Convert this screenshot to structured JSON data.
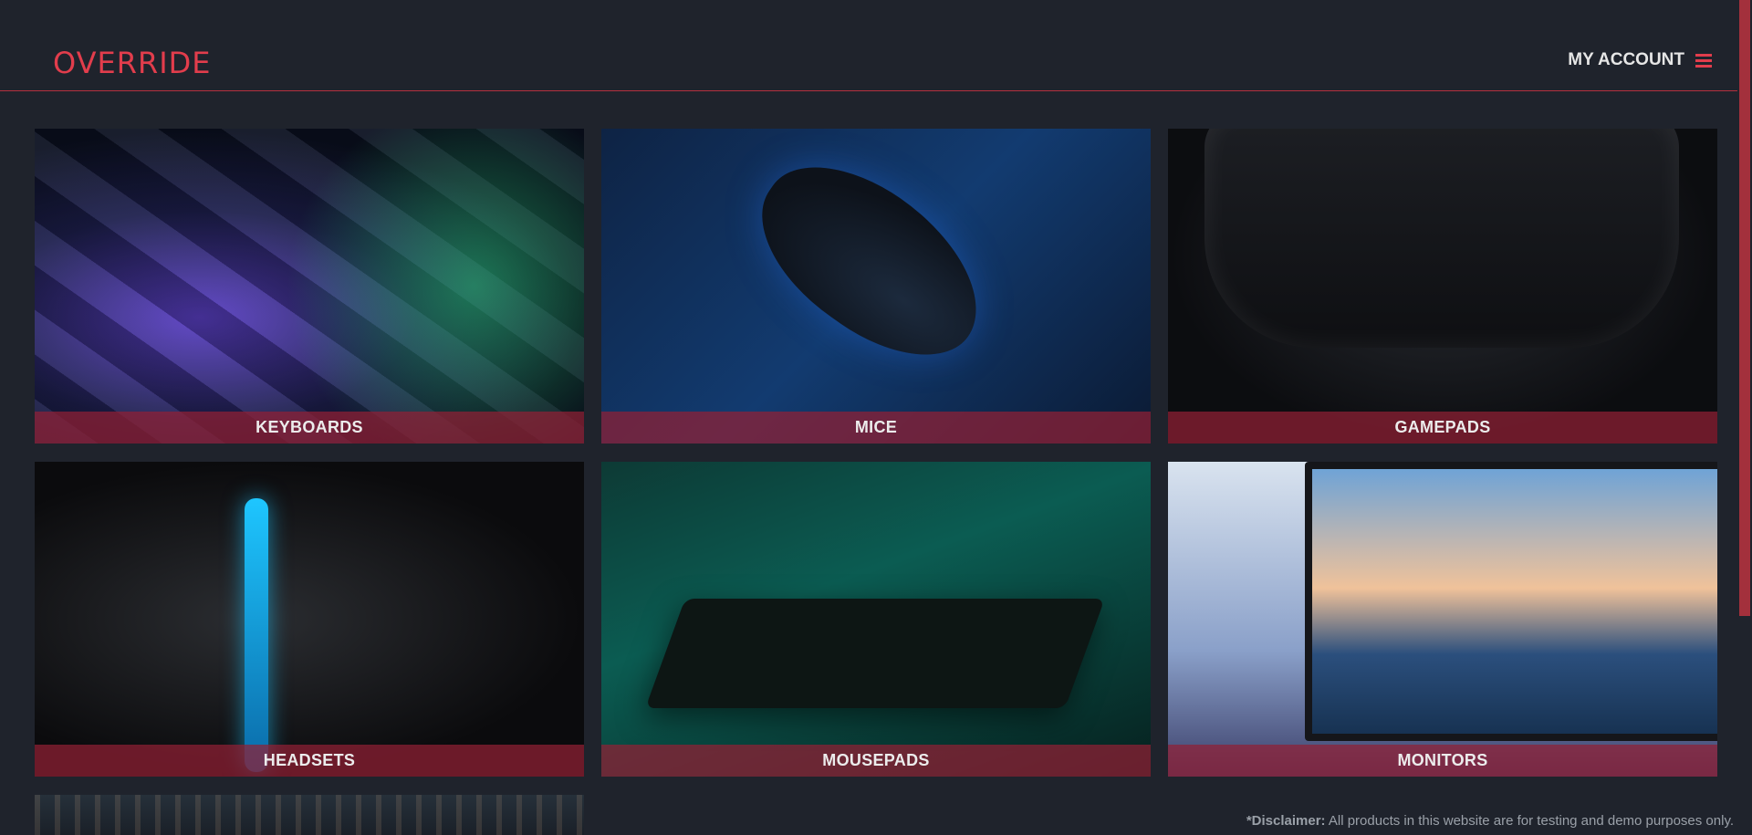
{
  "header": {
    "logo": "OVERRIDE",
    "account_label": "MY ACCOUNT",
    "menu_icon": "hamburger-icon"
  },
  "categories": [
    {
      "label": "KEYBOARDS"
    },
    {
      "label": "MICE"
    },
    {
      "label": "GAMEPADS"
    },
    {
      "label": "HEADSETS"
    },
    {
      "label": "MOUSEPADS"
    },
    {
      "label": "MONITORS"
    }
  ],
  "disclaimer": {
    "bold": "*Disclaimer:",
    "text": " All products in this website are for testing and demo purposes only."
  },
  "colors": {
    "background": "#1f232c",
    "accent": "#e23d4c",
    "label_bar": "#912034"
  }
}
